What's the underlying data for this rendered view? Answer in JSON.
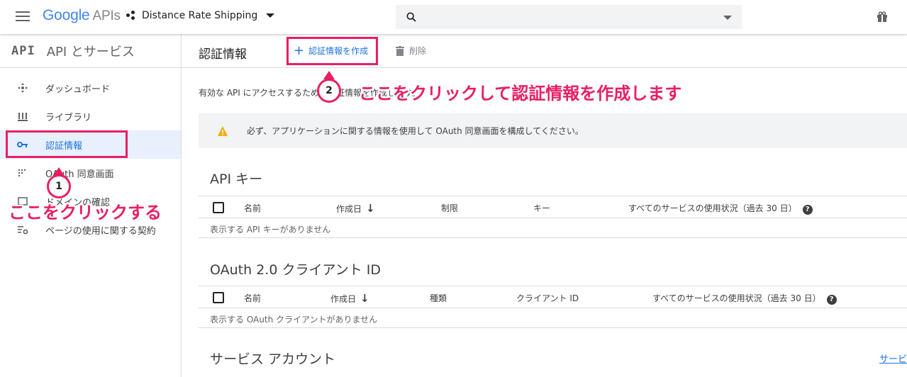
{
  "topbar": {
    "logo_google": "Google",
    "logo_apis": "APIs",
    "project_name": "Distance Rate Shipping",
    "search_placeholder": ""
  },
  "sidebar": {
    "logo_text": "API",
    "title": "API とサービス",
    "items": [
      {
        "label": "ダッシュボード",
        "icon": "dashboard-icon"
      },
      {
        "label": "ライブラリ",
        "icon": "library-icon"
      },
      {
        "label": "認証情報",
        "icon": "key-icon",
        "active": true
      },
      {
        "label": "OAuth 同意画面",
        "icon": "consent-icon"
      },
      {
        "label": "ドメインの確認",
        "icon": "domain-check-icon"
      },
      {
        "label": "ページの使用に関する契約",
        "icon": "settings-list-icon"
      }
    ]
  },
  "main": {
    "page_title": "認証情報",
    "create_label": "認証情報を作成",
    "delete_label": "削除",
    "intro_text": "有効な API にアクセスするための認証情報を作成します。",
    "warning_text": "必ず、アプリケーションに関する情報を使用して OAuth 同意画面を構成してください。",
    "api_keys": {
      "title": "API キー",
      "columns": [
        "名前",
        "作成日",
        "制限",
        "キー",
        "すべてのサービスの使用状況（過去 30 日）"
      ],
      "empty": "表示する API キーがありません"
    },
    "oauth_clients": {
      "title": "OAuth 2.0 クライアント ID",
      "columns": [
        "名前",
        "作成日",
        "種類",
        "クライアント ID",
        "すべてのサービスの使用状況（過去 30 日）"
      ],
      "empty": "表示する OAuth クライアントがありません"
    },
    "service_accounts": {
      "title": "サービス アカウント",
      "link": "サービ"
    }
  },
  "annotations": {
    "badge1": "1",
    "badge2": "2",
    "text1": "ここをクリックする",
    "text2": "ここをクリックして認証情報を作成します",
    "color": "#e91e63"
  }
}
